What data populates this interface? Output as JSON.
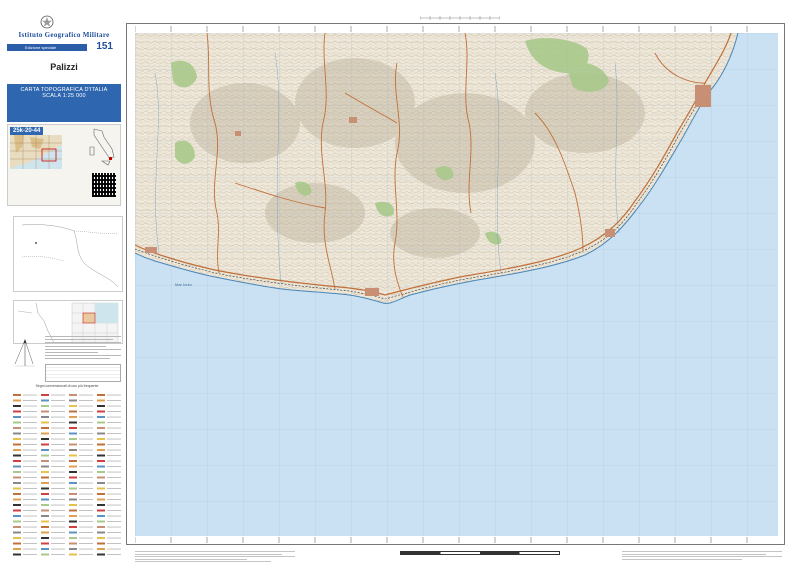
{
  "header": {
    "institute": "Istituto Geografico Militare",
    "edition_note": "Edizione speciale",
    "badge_number": "151"
  },
  "sheet": {
    "name": "Palizzi",
    "code": "25k-20-44"
  },
  "title_box": {
    "line1": "CARTA TOPOGRAFICA D'ITALIA",
    "line2": "SCALA 1:25 000"
  },
  "legend": {
    "title": "Segni convenzionali di uso più frequente"
  },
  "map": {
    "sea_label": "Mar Ionio"
  },
  "colors": {
    "sea": "#c9e1f2",
    "land": "#f3efe4",
    "forest": "#a9c98a",
    "road": "#c0703a",
    "brand_blue": "#2f66b0"
  }
}
